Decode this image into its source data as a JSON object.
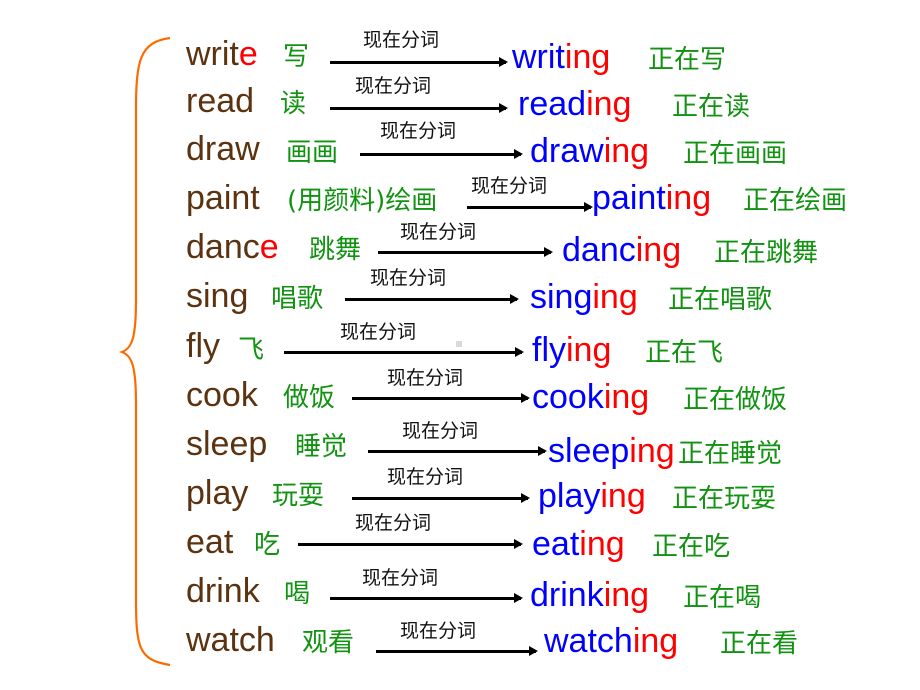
{
  "slide": {
    "arrow_label": "现在分词",
    "colors": {
      "base_word": "#5c3310",
      "highlight": "#ff0000",
      "participle": "#0000ff",
      "chinese": "#119211",
      "brace": "#ff6a00",
      "arrow": "#000000"
    },
    "rows": [
      {
        "base": "writ",
        "base_hl": "e",
        "meaning": "写",
        "stem": "writ",
        "suffix": "ing",
        "result_meaning": "正在写"
      },
      {
        "base": "read",
        "base_hl": "",
        "meaning": "读",
        "stem": "read",
        "suffix": "ing",
        "result_meaning": "正在读"
      },
      {
        "base": "draw",
        "base_hl": "",
        "meaning": "画画",
        "stem": "draw",
        "suffix": "ing",
        "result_meaning": "正在画画"
      },
      {
        "base": "paint",
        "base_hl": "",
        "meaning": "(用颜料)绘画",
        "stem": "paint",
        "suffix": "ing",
        "result_meaning": "正在绘画"
      },
      {
        "base": "danc",
        "base_hl": "e",
        "meaning": "跳舞",
        "stem": "danc",
        "suffix": "ing",
        "result_meaning": "正在跳舞"
      },
      {
        "base": "sing",
        "base_hl": "",
        "meaning": "唱歌",
        "stem": "sing",
        "suffix": "ing",
        "result_meaning": "正在唱歌"
      },
      {
        "base": "fly",
        "base_hl": "",
        "meaning": "飞",
        "stem": "fly",
        "suffix": "ing",
        "result_meaning": "正在飞"
      },
      {
        "base": "cook",
        "base_hl": "",
        "meaning": "做饭",
        "stem": "cook",
        "suffix": "ing",
        "result_meaning": "正在做饭"
      },
      {
        "base": "sleep",
        "base_hl": "",
        "meaning": "睡觉",
        "stem": "sleep",
        "suffix": "ing",
        "result_meaning": "正在睡觉"
      },
      {
        "base": "play",
        "base_hl": "",
        "meaning": "玩耍",
        "stem": "play",
        "suffix": "ing",
        "result_meaning": "正在玩耍"
      },
      {
        "base": "eat",
        "base_hl": "",
        "meaning": "吃",
        "stem": "eat",
        "suffix": "ing",
        "result_meaning": "正在吃"
      },
      {
        "base": "drink",
        "base_hl": "",
        "meaning": "喝",
        "stem": "drink",
        "suffix": "ing",
        "result_meaning": "正在喝"
      },
      {
        "base": "watch",
        "base_hl": "",
        "meaning": "观看",
        "stem": "watch",
        "suffix": "ing",
        "result_meaning": "正在看"
      }
    ]
  }
}
